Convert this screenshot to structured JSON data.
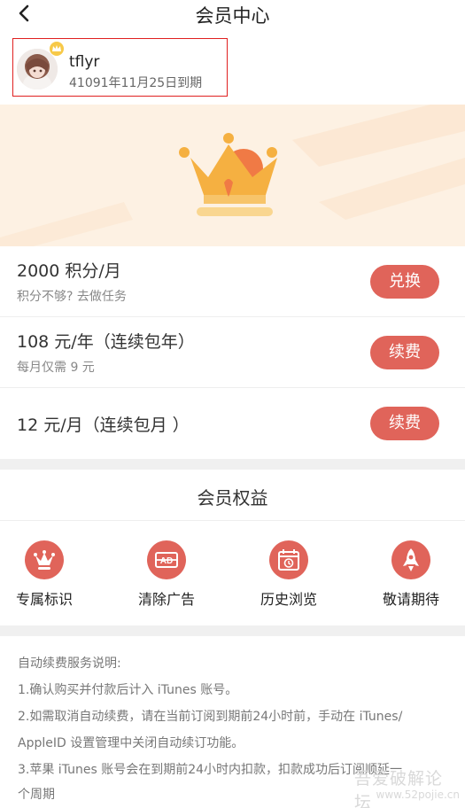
{
  "nav": {
    "title": "会员中心"
  },
  "user": {
    "name": "tflyr",
    "expire_text": "41091年11月25日到期"
  },
  "plans": [
    {
      "title": "2000 积分/月",
      "subtitle": "积分不够? 去做任务",
      "button": "兑换"
    },
    {
      "title": "108 元/年（连续包年）",
      "subtitle": "每月仅需 9 元",
      "button": "续费"
    },
    {
      "title": "12 元/月（连续包月 ）",
      "subtitle": "",
      "button": "续费"
    }
  ],
  "benefits": {
    "title": "会员权益",
    "items": [
      {
        "label": "专属标识",
        "icon": "crown-icon"
      },
      {
        "label": "清除广告",
        "icon": "ad-block-icon"
      },
      {
        "label": "历史浏览",
        "icon": "calendar-history-icon"
      },
      {
        "label": "敬请期待",
        "icon": "rocket-icon"
      }
    ]
  },
  "notes": [
    "自动续费服务说明:",
    "1.确认购买并付款后计入 iTunes 账号。",
    "2.如需取消自动续费，请在当前订阅到期前24小时前，手动在  iTunes/",
    "AppleID 设置管理中关闭自动续订功能。",
    "3.苹果 iTunes 账号会在到期前24小时内扣款，扣款成功后订阅顺延一",
    "个周期"
  ],
  "watermark": {
    "line1": "吾爱破解论坛",
    "line2": "www.52pojie.cn"
  },
  "colors": {
    "accent": "#e0645a",
    "banner_bg": "#fdf1e3",
    "crown": "#f5b041"
  }
}
